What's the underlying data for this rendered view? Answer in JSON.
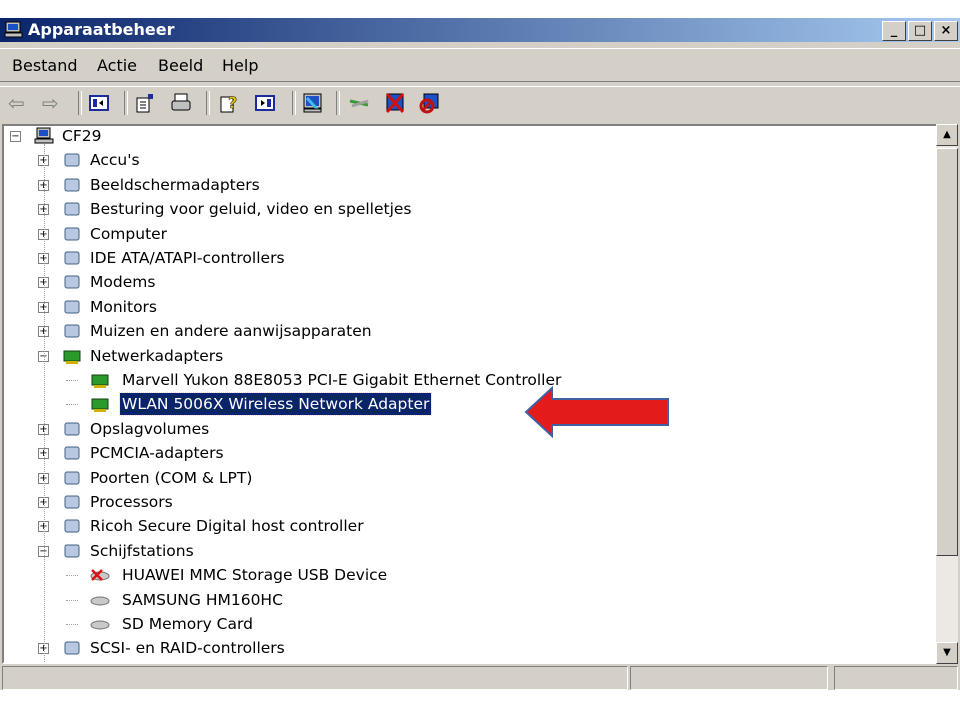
{
  "window": {
    "title": "Apparaatbeheer",
    "minimize": "_",
    "maximize": "□",
    "close": "×"
  },
  "menu": [
    "Bestand",
    "Actie",
    "Beeld",
    "Help"
  ],
  "toolbar": [
    "back-icon",
    "forward-icon",
    "show-hide-tree-icon",
    "properties-icon",
    "print-icon",
    "help-icon",
    "show-hide-action-pane-icon",
    "scan-hardware-icon",
    "update-driver-icon",
    "uninstall-icon",
    "disable-icon"
  ],
  "tree": [
    {
      "label": "CF29",
      "level": 0,
      "exp": "-"
    },
    {
      "label": "Accu's",
      "level": 1,
      "exp": "+"
    },
    {
      "label": "Beeldschermadapters",
      "level": 1,
      "exp": "+"
    },
    {
      "label": "Besturing voor geluid, video en spelletjes",
      "level": 1,
      "exp": "+"
    },
    {
      "label": "Computer",
      "level": 1,
      "exp": "+"
    },
    {
      "label": "IDE ATA/ATAPI-controllers",
      "level": 1,
      "exp": "+"
    },
    {
      "label": "Modems",
      "level": 1,
      "exp": "+"
    },
    {
      "label": "Monitors",
      "level": 1,
      "exp": "+"
    },
    {
      "label": "Muizen en andere aanwijsapparaten",
      "level": 1,
      "exp": "+"
    },
    {
      "label": "Netwerkadapters",
      "level": 1,
      "exp": "-"
    },
    {
      "label": "Marvell Yukon 88E8053 PCI-E Gigabit Ethernet Controller",
      "level": 2,
      "exp": ""
    },
    {
      "label": "WLAN 5006X Wireless Network Adapter",
      "level": 2,
      "exp": "",
      "selected": true
    },
    {
      "label": "Opslagvolumes",
      "level": 1,
      "exp": "+"
    },
    {
      "label": "PCMCIA-adapters",
      "level": 1,
      "exp": "+"
    },
    {
      "label": "Poorten (COM & LPT)",
      "level": 1,
      "exp": "+"
    },
    {
      "label": "Processors",
      "level": 1,
      "exp": "+"
    },
    {
      "label": "Ricoh Secure Digital host controller",
      "level": 1,
      "exp": "+"
    },
    {
      "label": "Schijfstations",
      "level": 1,
      "exp": "-"
    },
    {
      "label": "HUAWEI MMC Storage USB Device",
      "level": 2,
      "exp": "",
      "disabled": true
    },
    {
      "label": "SAMSUNG HM160HC",
      "level": 2,
      "exp": ""
    },
    {
      "label": "SD Memory Card",
      "level": 2,
      "exp": ""
    },
    {
      "label": "SCSI- en RAID-controllers",
      "level": 1,
      "exp": "+"
    }
  ],
  "colors": {
    "selection": "#0a246a",
    "arrow": "#e31b1b",
    "titlebar": "#0a246a"
  }
}
